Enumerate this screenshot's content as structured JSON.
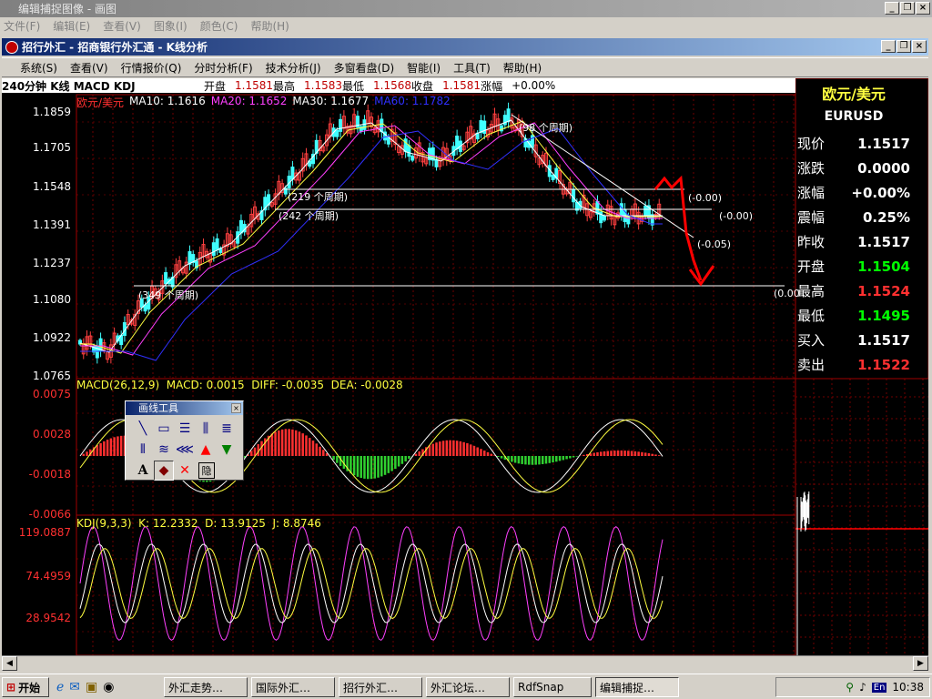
{
  "window": {
    "title": "编辑捕捉图像 - 画图",
    "menus": [
      "文件(F)",
      "编辑(E)",
      "查看(V)",
      "图象(I)",
      "颜色(C)",
      "帮助(H)"
    ]
  },
  "child_window": {
    "title": "招行外汇 - 招商银行外汇通 - K线分析"
  },
  "app_menu": [
    "系统(S)",
    "查看(V)",
    "行情报价(Q)",
    "分时分析(F)",
    "技术分析(J)",
    "多窗看盘(D)",
    "智能(I)",
    "工具(T)",
    "帮助(H)"
  ],
  "info_bar": {
    "period": "240分钟 K线 MACD KDJ",
    "open_label": "开盘",
    "open": "1.1581",
    "high_label": "最高",
    "high": "1.1583",
    "low_label": "最低",
    "low": "1.1568",
    "close_label": "收盘",
    "close": "1.1581",
    "change_label": "涨幅",
    "change": "+0.00%"
  },
  "main_chart": {
    "symbol_cn": "欧元/美元",
    "ma_legend": [
      "MA10: 1.1616",
      "MA20: 1.1652",
      "MA30: 1.1677",
      "MA60: 1.1782"
    ],
    "y_ticks": [
      "1.1859",
      "1.1705",
      "1.1548",
      "1.1391",
      "1.1237",
      "1.1080",
      "1.0922",
      "1.0765"
    ],
    "annotations": [
      "(219 个周期)",
      "(242 个周期)",
      "(349 个周期)",
      "(98 个周期)",
      "(-0.00)",
      "(-0.00)",
      "(-0.05)",
      "(0.00"
    ]
  },
  "macd": {
    "legend": "MACD(26,12,9)  MACD: 0.0015  DIFF: -0.0035  DEA: -0.0028",
    "y_ticks": [
      "0.0075",
      "0.0028",
      "-0.0018",
      "-0.0066"
    ]
  },
  "kdj": {
    "legend": "KDJ(9,3,3)  K: 12.2332  D: 13.9125  J: 8.8746",
    "y_ticks": [
      "119.0887",
      "74.4959",
      "28.9542"
    ]
  },
  "quote_panel": {
    "name_cn": "欧元/美元",
    "code": "EURUSD",
    "rows": [
      {
        "label": "现价",
        "value": "1.1517",
        "color": "#ffffff"
      },
      {
        "label": "涨跌",
        "value": "0.0000",
        "color": "#ffffff"
      },
      {
        "label": "涨幅",
        "value": "+0.00%",
        "color": "#ffffff"
      },
      {
        "label": "震幅",
        "value": "0.25%",
        "color": "#ffffff"
      },
      {
        "label": "昨收",
        "value": "1.1517",
        "color": "#ffffff"
      },
      {
        "label": "开盘",
        "value": "1.1504",
        "color": "#00ff00"
      },
      {
        "label": "最高",
        "value": "1.1524",
        "color": "#ff3030"
      },
      {
        "label": "最低",
        "value": "1.1495",
        "color": "#00ff00"
      },
      {
        "label": "买入",
        "value": "1.1517",
        "color": "#ffffff"
      },
      {
        "label": "卖出",
        "value": "1.1522",
        "color": "#ff3030"
      }
    ]
  },
  "toolbox": {
    "title": "画线工具",
    "text_tool": "A",
    "hide_tool": "隐"
  },
  "taskbar": {
    "start": "开始",
    "tasks": [
      "外汇走势…",
      "国际外汇…",
      "招行外汇…",
      "外汇论坛…",
      "RdfSnap",
      "编辑捕捉…"
    ],
    "clock": "10:38",
    "lang": "En"
  }
}
